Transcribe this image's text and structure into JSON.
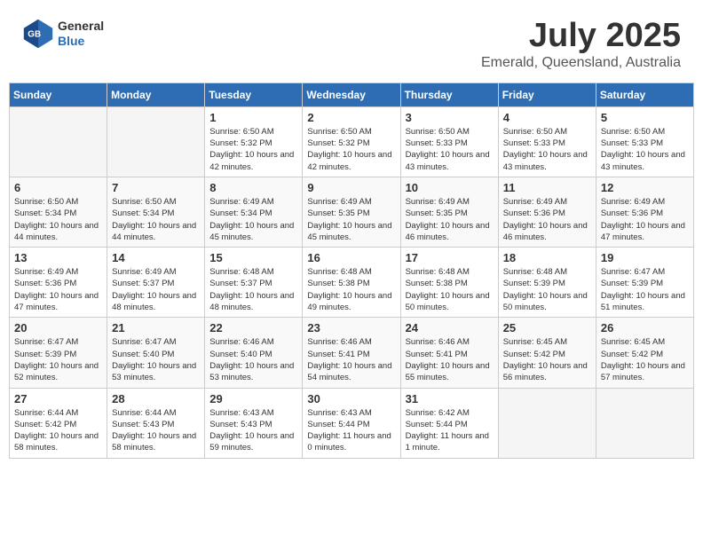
{
  "header": {
    "logo_line1": "General",
    "logo_line2": "Blue",
    "month": "July 2025",
    "location": "Emerald, Queensland, Australia"
  },
  "weekdays": [
    "Sunday",
    "Monday",
    "Tuesday",
    "Wednesday",
    "Thursday",
    "Friday",
    "Saturday"
  ],
  "weeks": [
    [
      {
        "day": "",
        "info": ""
      },
      {
        "day": "",
        "info": ""
      },
      {
        "day": "1",
        "info": "Sunrise: 6:50 AM\nSunset: 5:32 PM\nDaylight: 10 hours and 42 minutes."
      },
      {
        "day": "2",
        "info": "Sunrise: 6:50 AM\nSunset: 5:32 PM\nDaylight: 10 hours and 42 minutes."
      },
      {
        "day": "3",
        "info": "Sunrise: 6:50 AM\nSunset: 5:33 PM\nDaylight: 10 hours and 43 minutes."
      },
      {
        "day": "4",
        "info": "Sunrise: 6:50 AM\nSunset: 5:33 PM\nDaylight: 10 hours and 43 minutes."
      },
      {
        "day": "5",
        "info": "Sunrise: 6:50 AM\nSunset: 5:33 PM\nDaylight: 10 hours and 43 minutes."
      }
    ],
    [
      {
        "day": "6",
        "info": "Sunrise: 6:50 AM\nSunset: 5:34 PM\nDaylight: 10 hours and 44 minutes."
      },
      {
        "day": "7",
        "info": "Sunrise: 6:50 AM\nSunset: 5:34 PM\nDaylight: 10 hours and 44 minutes."
      },
      {
        "day": "8",
        "info": "Sunrise: 6:49 AM\nSunset: 5:34 PM\nDaylight: 10 hours and 45 minutes."
      },
      {
        "day": "9",
        "info": "Sunrise: 6:49 AM\nSunset: 5:35 PM\nDaylight: 10 hours and 45 minutes."
      },
      {
        "day": "10",
        "info": "Sunrise: 6:49 AM\nSunset: 5:35 PM\nDaylight: 10 hours and 46 minutes."
      },
      {
        "day": "11",
        "info": "Sunrise: 6:49 AM\nSunset: 5:36 PM\nDaylight: 10 hours and 46 minutes."
      },
      {
        "day": "12",
        "info": "Sunrise: 6:49 AM\nSunset: 5:36 PM\nDaylight: 10 hours and 47 minutes."
      }
    ],
    [
      {
        "day": "13",
        "info": "Sunrise: 6:49 AM\nSunset: 5:36 PM\nDaylight: 10 hours and 47 minutes."
      },
      {
        "day": "14",
        "info": "Sunrise: 6:49 AM\nSunset: 5:37 PM\nDaylight: 10 hours and 48 minutes."
      },
      {
        "day": "15",
        "info": "Sunrise: 6:48 AM\nSunset: 5:37 PM\nDaylight: 10 hours and 48 minutes."
      },
      {
        "day": "16",
        "info": "Sunrise: 6:48 AM\nSunset: 5:38 PM\nDaylight: 10 hours and 49 minutes."
      },
      {
        "day": "17",
        "info": "Sunrise: 6:48 AM\nSunset: 5:38 PM\nDaylight: 10 hours and 50 minutes."
      },
      {
        "day": "18",
        "info": "Sunrise: 6:48 AM\nSunset: 5:39 PM\nDaylight: 10 hours and 50 minutes."
      },
      {
        "day": "19",
        "info": "Sunrise: 6:47 AM\nSunset: 5:39 PM\nDaylight: 10 hours and 51 minutes."
      }
    ],
    [
      {
        "day": "20",
        "info": "Sunrise: 6:47 AM\nSunset: 5:39 PM\nDaylight: 10 hours and 52 minutes."
      },
      {
        "day": "21",
        "info": "Sunrise: 6:47 AM\nSunset: 5:40 PM\nDaylight: 10 hours and 53 minutes."
      },
      {
        "day": "22",
        "info": "Sunrise: 6:46 AM\nSunset: 5:40 PM\nDaylight: 10 hours and 53 minutes."
      },
      {
        "day": "23",
        "info": "Sunrise: 6:46 AM\nSunset: 5:41 PM\nDaylight: 10 hours and 54 minutes."
      },
      {
        "day": "24",
        "info": "Sunrise: 6:46 AM\nSunset: 5:41 PM\nDaylight: 10 hours and 55 minutes."
      },
      {
        "day": "25",
        "info": "Sunrise: 6:45 AM\nSunset: 5:42 PM\nDaylight: 10 hours and 56 minutes."
      },
      {
        "day": "26",
        "info": "Sunrise: 6:45 AM\nSunset: 5:42 PM\nDaylight: 10 hours and 57 minutes."
      }
    ],
    [
      {
        "day": "27",
        "info": "Sunrise: 6:44 AM\nSunset: 5:42 PM\nDaylight: 10 hours and 58 minutes."
      },
      {
        "day": "28",
        "info": "Sunrise: 6:44 AM\nSunset: 5:43 PM\nDaylight: 10 hours and 58 minutes."
      },
      {
        "day": "29",
        "info": "Sunrise: 6:43 AM\nSunset: 5:43 PM\nDaylight: 10 hours and 59 minutes."
      },
      {
        "day": "30",
        "info": "Sunrise: 6:43 AM\nSunset: 5:44 PM\nDaylight: 11 hours and 0 minutes."
      },
      {
        "day": "31",
        "info": "Sunrise: 6:42 AM\nSunset: 5:44 PM\nDaylight: 11 hours and 1 minute."
      },
      {
        "day": "",
        "info": ""
      },
      {
        "day": "",
        "info": ""
      }
    ]
  ]
}
